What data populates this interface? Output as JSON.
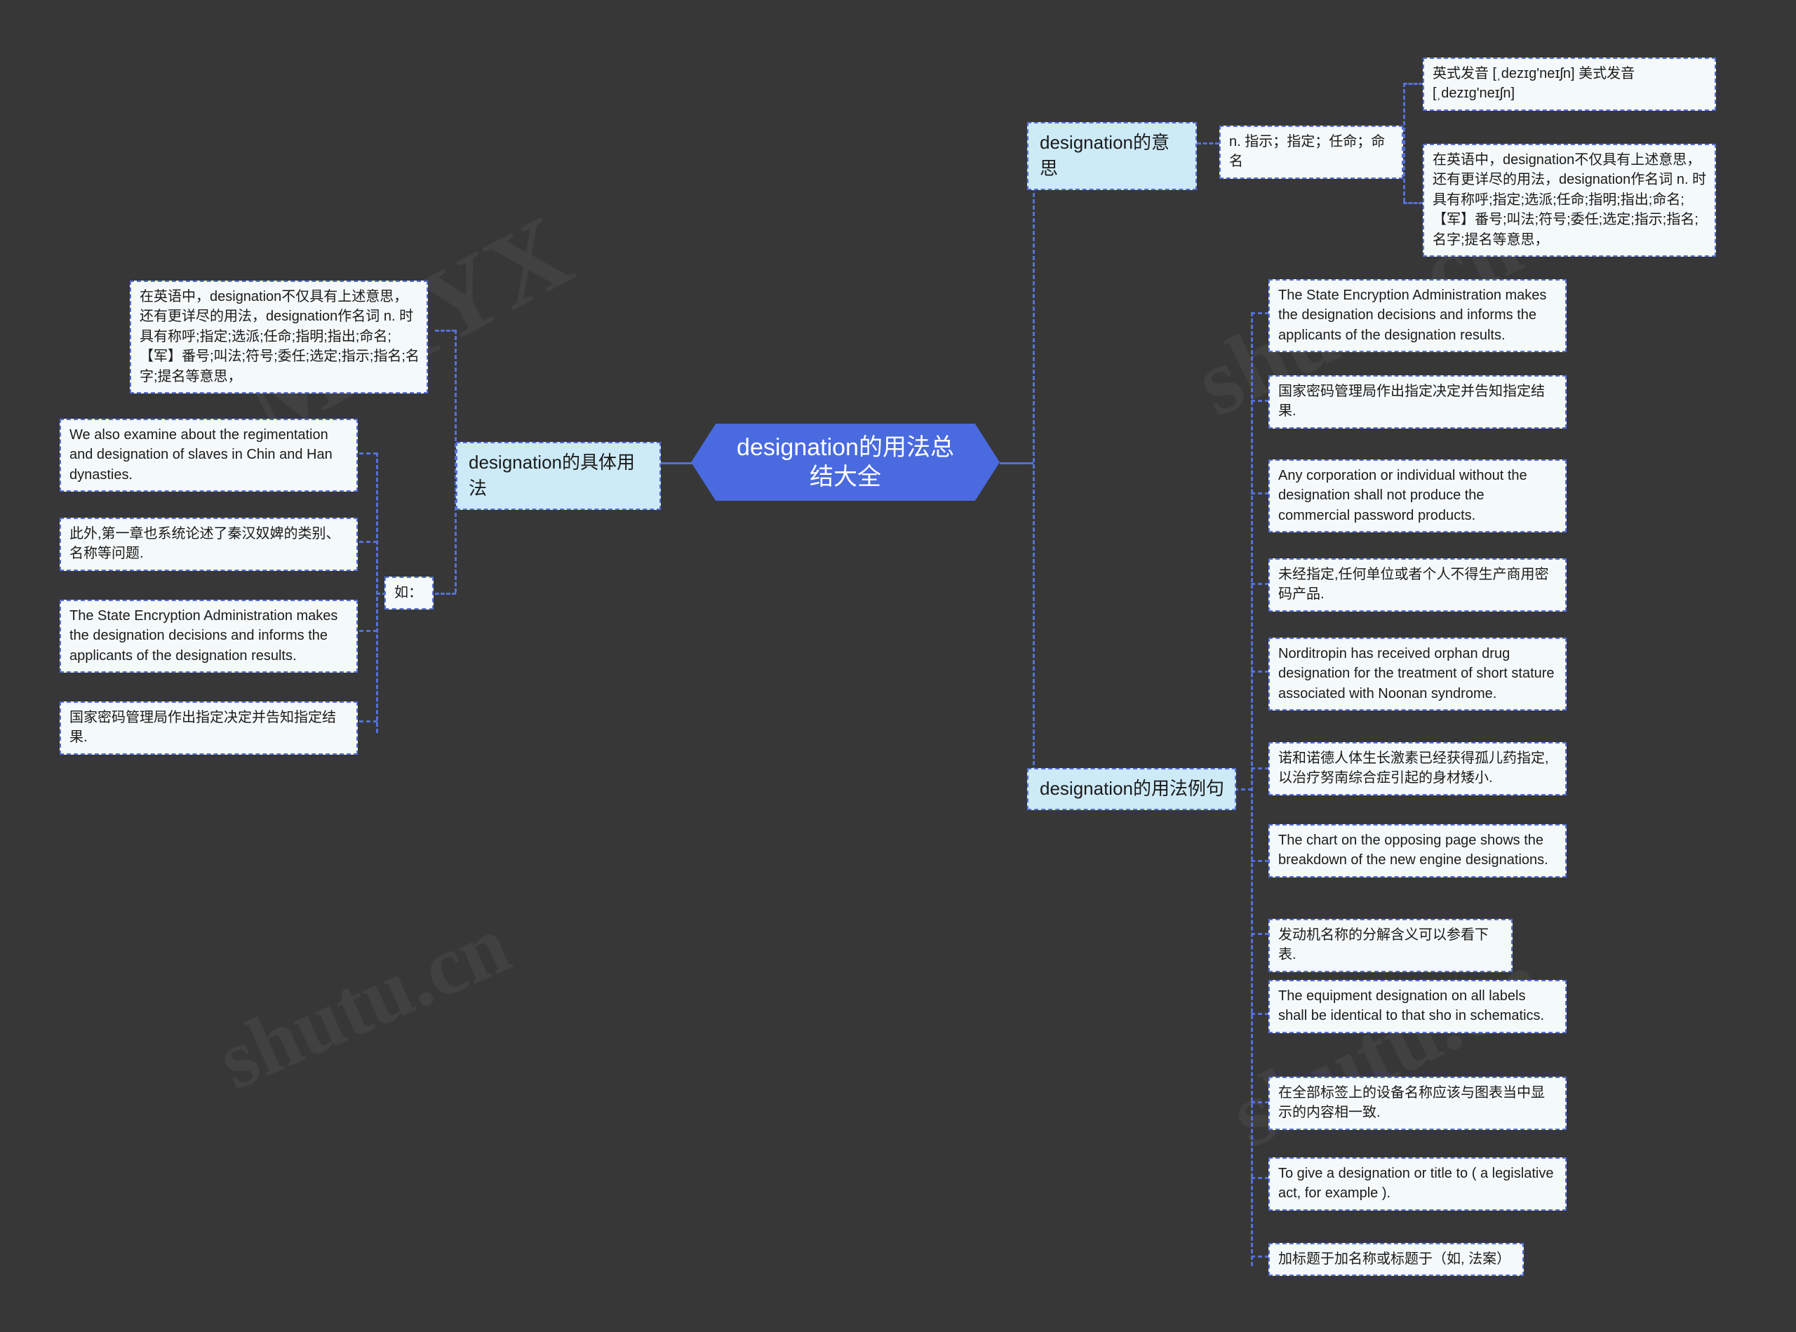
{
  "theme": {
    "background": "#373737",
    "root_fill": "#4a6ae0",
    "root_text": "#ffffff",
    "branch_fill": "#cdeaf7",
    "leaf_fill": "#f4f9f9",
    "connector": "#5570d8",
    "node_text": "#1b1b1b"
  },
  "watermarks": [
    "MMYX",
    "shutu.cn",
    "shutu.cn",
    "shutu.cn"
  ],
  "root": {
    "label": "designation的用法总结大全"
  },
  "branches": {
    "meaning": {
      "label": "designation的意思",
      "children": [
        {
          "label": "n. 指示；指定；任命；命名",
          "children": [
            {
              "label": "英式发音 [ˌdezɪɡ'neɪʃn] 美式发音 [ˌdezɪɡ'neɪʃn]"
            },
            {
              "label": "在英语中，designation不仅具有上述意思，还有更详尽的用法，designation作名词 n. 时具有称呼;指定;选派;任命;指明;指出;命名;【军】番号;叫法;符号;委任;选定;指示;指名;名字;提名等意思，"
            }
          ]
        }
      ]
    },
    "specific_usage": {
      "label": "designation的具体用法",
      "children": [
        {
          "label": "在英语中，designation不仅具有上述意思，还有更详尽的用法，designation作名词 n. 时具有称呼;指定;选派;任命;指明;指出;命名;【军】番号;叫法;符号;委任;选定;指示;指名;名字;提名等意思，"
        },
        {
          "label": "如：",
          "children": [
            {
              "label": "We also examine about the regimentation and designation of slaves in Chin and Han dynasties."
            },
            {
              "label": "此外,第一章也系统论述了秦汉奴婢的类别、名称等问题."
            },
            {
              "label": "The State Encryption Administration makes the designation decisions and informs the applicants of the designation results."
            },
            {
              "label": "国家密码管理局作出指定决定并告知指定结果."
            }
          ]
        }
      ]
    },
    "examples": {
      "label": "designation的用法例句",
      "children": [
        {
          "label": "The State Encryption Administration makes the designation decisions and informs the applicants of the designation results."
        },
        {
          "label": "国家密码管理局作出指定决定并告知指定结果."
        },
        {
          "label": "Any corporation or individual without the designation shall not produce the commercial password products."
        },
        {
          "label": "未经指定,任何单位或者个人不得生产商用密码产品."
        },
        {
          "label": "Norditropin has received orphan drug designation for the treatment of short stature associated with Noonan syndrome."
        },
        {
          "label": "诺和诺德人体生长激素已经获得孤儿药指定,以治疗努南综合症引起的身材矮小."
        },
        {
          "label": "The chart on the opposing page shows the breakdown of the new engine designations."
        },
        {
          "label": "发动机名称的分解含义可以参看下表."
        },
        {
          "label": "The equipment designation on all labels shall be identical to that sho in schematics."
        },
        {
          "label": "在全部标签上的设备名称应该与图表当中显示的内容相一致."
        },
        {
          "label": "To give a designation or title to ( a legislative act, for example )."
        },
        {
          "label": "加标题于加名称或标题于（如, 法案）"
        }
      ]
    }
  }
}
